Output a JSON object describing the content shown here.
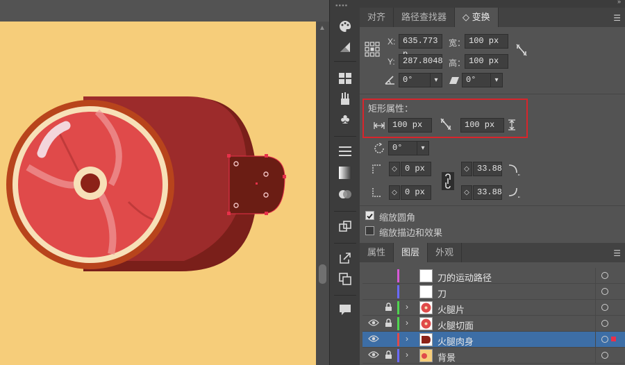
{
  "transform_tabs": [
    {
      "label": "对齐"
    },
    {
      "label": "路径查找器"
    },
    {
      "label": "◇ 变换"
    }
  ],
  "transform": {
    "x_label": "X:",
    "x_value": "635.773 p",
    "y_label": "Y:",
    "y_value": "287.8048",
    "width_label": "宽：",
    "width_value": "100 px",
    "height_label": "高：",
    "height_value": "100 px",
    "rotate_value": "0°",
    "shear_value": "0°"
  },
  "rect_props": {
    "title": "矩形属性：",
    "width_value": "100 px",
    "height_value": "100 px",
    "rotate_value": "0°",
    "corner_tl_value": "0 px",
    "corner_tr_value": "33.88",
    "corner_bl_value": "0 px",
    "corner_br_value": "33.88"
  },
  "options": {
    "scale_corners_label": "缩放圆角",
    "scale_corners_checked": true,
    "scale_strokes_label": "缩放描边和效果",
    "scale_strokes_checked": false
  },
  "layers_tabs": [
    {
      "label": "属性"
    },
    {
      "label": "图层"
    },
    {
      "label": "外观"
    }
  ],
  "layers": [
    {
      "name": "刀的运动路径",
      "color": "#d659d6",
      "visible": false,
      "locked": false,
      "expandable": false,
      "selected": false
    },
    {
      "name": "刀",
      "color": "#6a6aff",
      "visible": false,
      "locked": false,
      "expandable": false,
      "selected": false
    },
    {
      "name": "火腿片",
      "color": "#4fd44f",
      "visible": false,
      "locked": true,
      "expandable": true,
      "selected": false
    },
    {
      "name": "火腿切面",
      "color": "#4fd44f",
      "visible": true,
      "locked": true,
      "expandable": true,
      "selected": false
    },
    {
      "name": "火腿肉身",
      "color": "#e04a4a",
      "visible": true,
      "locked": false,
      "expandable": true,
      "selected": true
    },
    {
      "name": "背景",
      "color": "#6a6aff",
      "visible": true,
      "locked": true,
      "expandable": true,
      "selected": false
    }
  ],
  "colors": {
    "artboard": "#f6cd7a",
    "selection": "#e8304a",
    "highlight": "#d9242b",
    "layer_selected": "#3d6ea6"
  }
}
